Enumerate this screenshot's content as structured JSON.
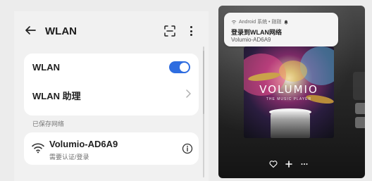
{
  "settings": {
    "title": "WLAN",
    "toggle_row": {
      "label": "WLAN",
      "enabled": true
    },
    "helper_row": {
      "label": "WLAN 助理"
    },
    "saved_section_label": "已保存网络",
    "saved_network": {
      "name": "Volumio-AD6A9",
      "status": "需要认证/登录"
    },
    "icons": [
      "back-arrow-icon",
      "scan-icon",
      "more-vert-icon",
      "chevron-right-icon",
      "wifi-icon",
      "info-icon"
    ],
    "accent_color": "#2f6de0"
  },
  "player": {
    "notification": {
      "source": "Android 系统 • 刚刚",
      "title": "登录到WLAN网络",
      "subtitle": "Volumio-AD6A9"
    },
    "album_art": {
      "brand": "VOLUMIO",
      "tagline": "THE MUSIC PLAYER"
    },
    "controls": [
      "heart-icon",
      "add-icon",
      "more-horiz-icon"
    ]
  }
}
